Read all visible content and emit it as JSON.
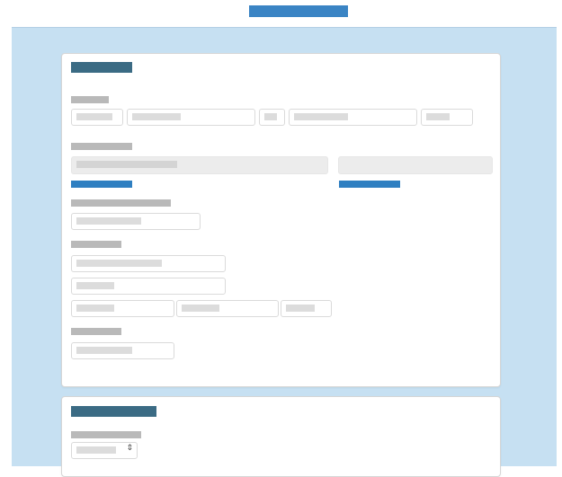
{
  "top": {
    "link_label": ""
  },
  "form": {
    "title": "",
    "sections": [
      {
        "id": "name",
        "label": "",
        "fields": [
          "",
          "",
          "",
          "",
          ""
        ]
      },
      {
        "id": "email",
        "label": "",
        "fields": [
          "",
          ""
        ],
        "links": [
          "",
          ""
        ]
      },
      {
        "id": "phone",
        "label": "",
        "fields": [
          ""
        ]
      },
      {
        "id": "address",
        "label": "",
        "fields": [
          "",
          "",
          "",
          "",
          ""
        ]
      },
      {
        "id": "extra",
        "label": "",
        "fields": [
          ""
        ]
      }
    ]
  },
  "second_card": {
    "title": "",
    "field_label": "",
    "select_value": ""
  },
  "colors": {
    "page_bg": "#c6e0f2",
    "heading": "#3b6b84",
    "link": "#2f7fc1",
    "top_link": "#3a84c4",
    "label": "#b9b9b9"
  },
  "icons": {
    "select_arrow": "up-down-arrow-icon"
  }
}
